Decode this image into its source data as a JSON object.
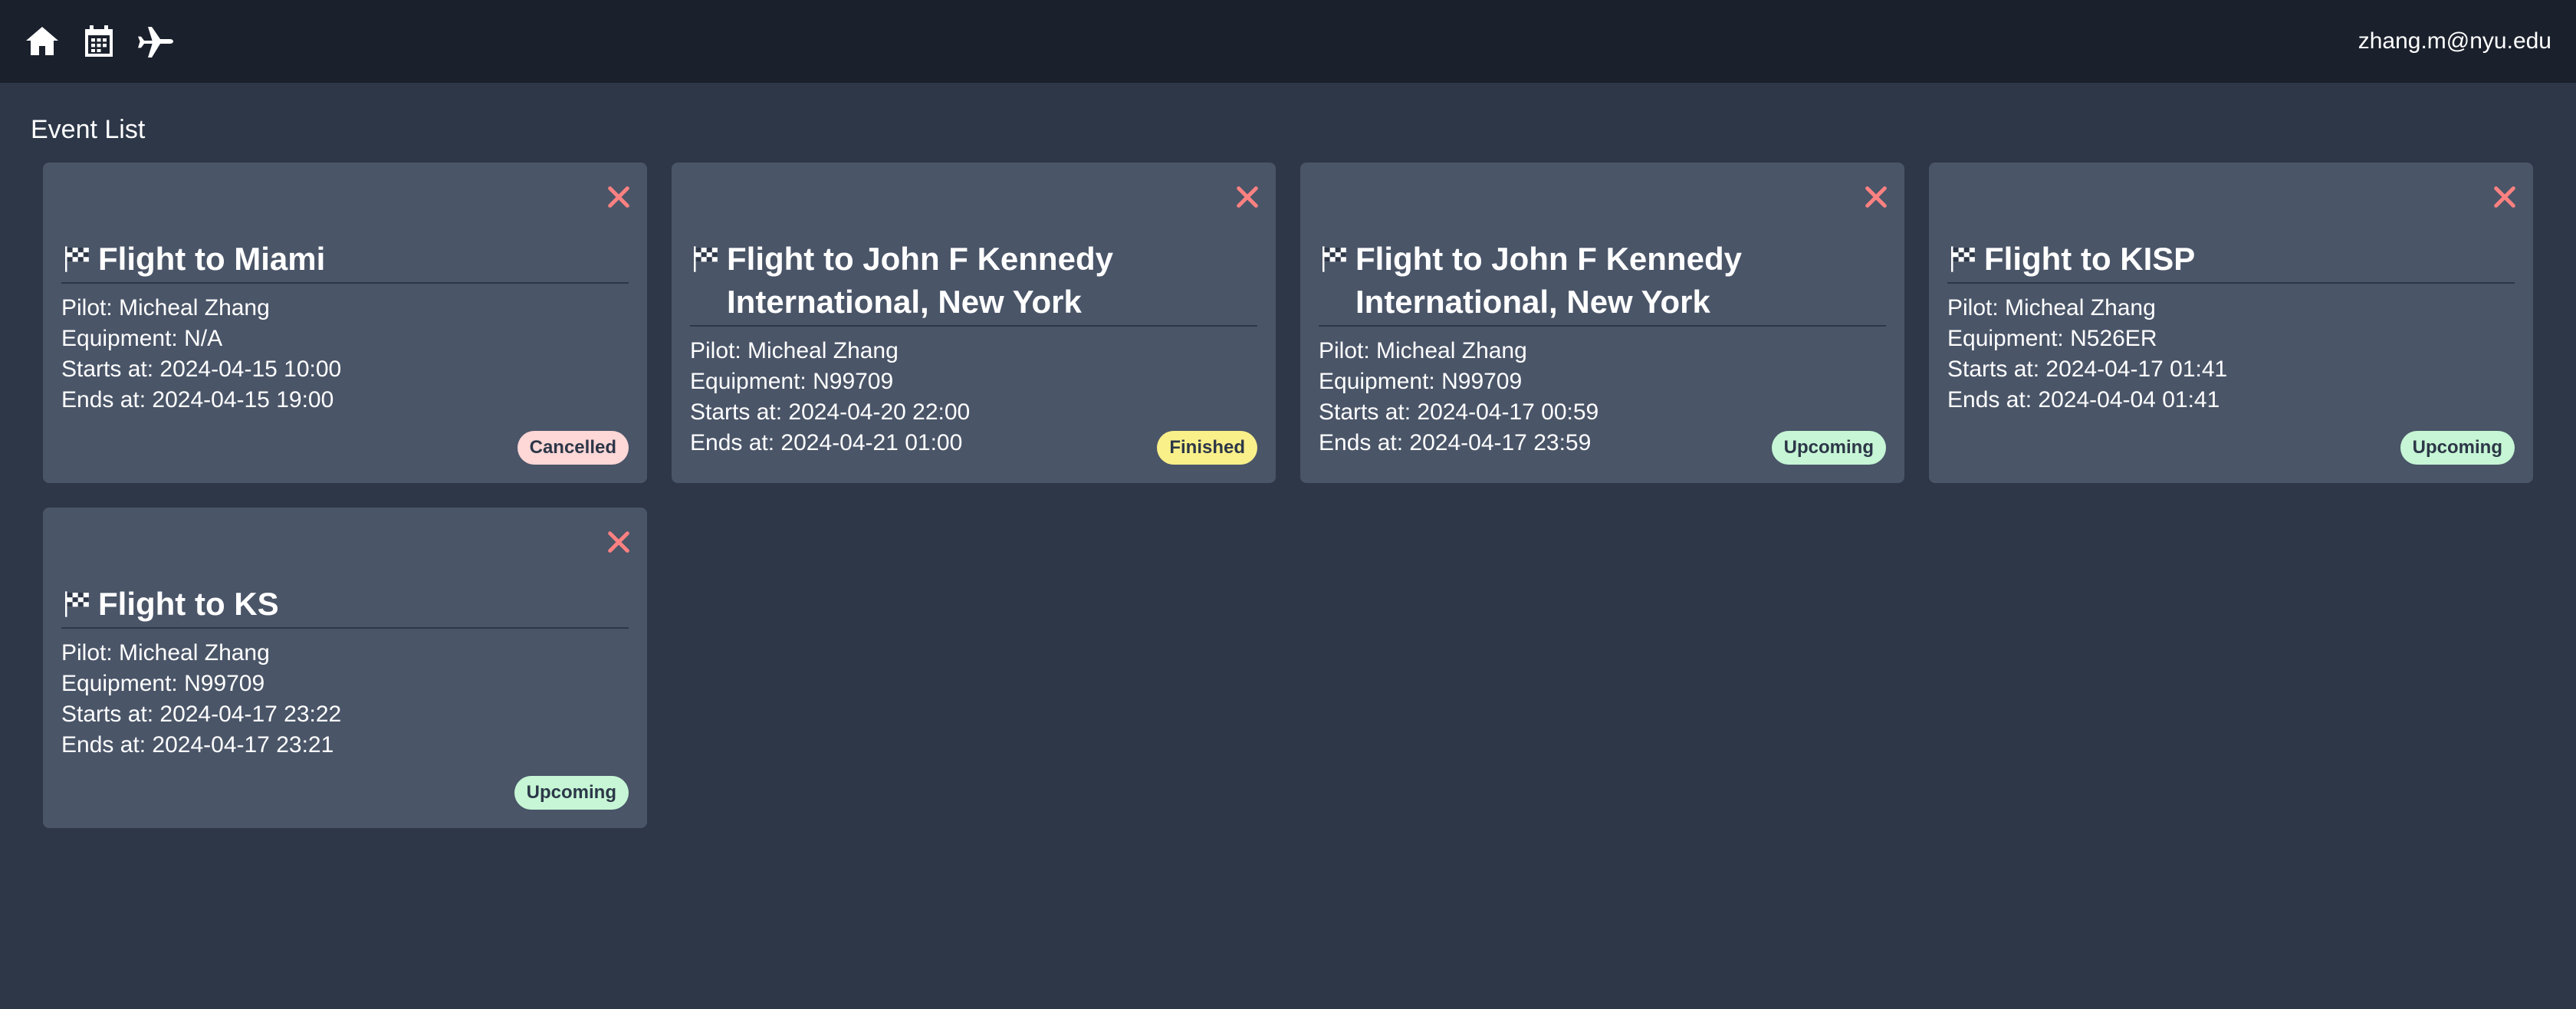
{
  "header": {
    "user_email": "zhang.m@nyu.edu",
    "nav_icons": [
      "home-icon",
      "calendar-icon",
      "plane-icon"
    ]
  },
  "page": {
    "title": "Event List"
  },
  "events": [
    {
      "title": "Flight to Miami",
      "pilot": "Pilot: Micheal Zhang",
      "equipment": "Equipment: N/A",
      "starts": "Starts at: 2024-04-15 10:00",
      "ends": "Ends at: 2024-04-15 19:00",
      "status": "Cancelled",
      "status_color": "#fed7d7"
    },
    {
      "title": "Flight to John F Kennedy International, New York",
      "pilot": "Pilot: Micheal Zhang",
      "equipment": "Equipment: N99709",
      "starts": "Starts at: 2024-04-20 22:00",
      "ends": "Ends at: 2024-04-21 01:00",
      "status": "Finished",
      "status_color": "#faf089"
    },
    {
      "title": "Flight to John F Kennedy International, New York",
      "pilot": "Pilot: Micheal Zhang",
      "equipment": "Equipment: N99709",
      "starts": "Starts at: 2024-04-17 00:59",
      "ends": "Ends at: 2024-04-17 23:59",
      "status": "Upcoming",
      "status_color": "#c6f6d5"
    },
    {
      "title": "Flight to KISP",
      "pilot": "Pilot: Micheal Zhang",
      "equipment": "Equipment: N526ER",
      "starts": "Starts at: 2024-04-17 01:41",
      "ends": "Ends at: 2024-04-04 01:41",
      "status": "Upcoming",
      "status_color": "#c6f6d5"
    },
    {
      "title": "Flight to KS",
      "pilot": "Pilot: Micheal Zhang",
      "equipment": "Equipment: N99709",
      "starts": "Starts at: 2024-04-17 23:22",
      "ends": "Ends at: 2024-04-17 23:21",
      "status": "Upcoming",
      "status_color": "#c6f6d5"
    }
  ]
}
